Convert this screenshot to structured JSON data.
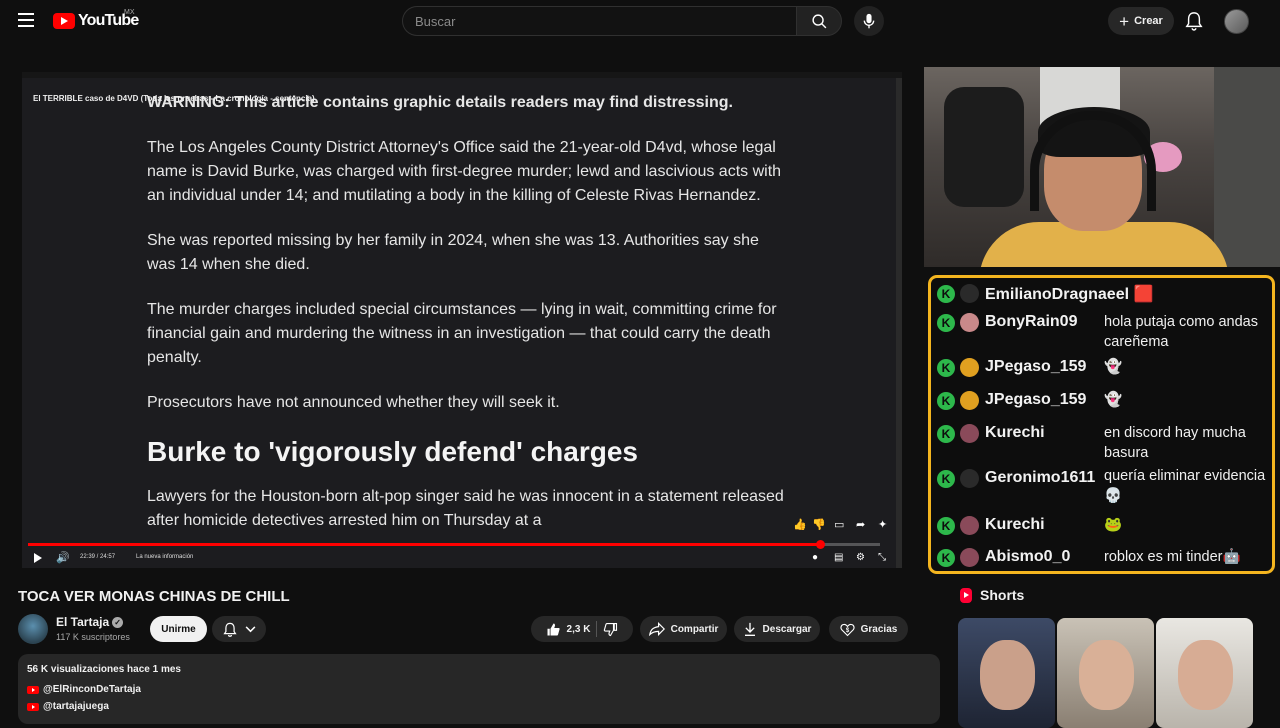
{
  "header": {
    "logo_text": "YouTube",
    "region": "MX",
    "search_placeholder": "Buscar",
    "create_label": "Crear"
  },
  "player": {
    "overlay_title": "El TERRIBLE caso de D4VD (Toda las pruebas - La cronología - sentencia)",
    "article": {
      "warning": "WARNING: This article contains graphic details readers may find distressing.",
      "paragraphs": [
        "The Los Angeles County District Attorney's Office said the 21-year-old D4vd, whose legal name is David Burke, was charged with first-degree murder; lewd and lascivious acts with an individual under 14; and mutilating a body in the killing of Celeste Rivas Hernandez.",
        "She was reported missing by her family in 2024, when she was 13. Authorities say she was 14 when she died.",
        "The murder charges included special circumstances — lying in wait, committing crime for financial gain and murdering the witness in an investigation — that could carry the death penalty.",
        "Prosecutors have not announced whether they will seek it."
      ],
      "heading": "Burke to 'vigorously defend' charges",
      "final_paragraph": "Lawyers for the Houston-born alt-pop singer said he was innocent in a statement released after homicide detectives arrested him on Thursday at a"
    },
    "time": "22:39 / 24:57",
    "chapter": "La nueva información",
    "progress_fraction": 0.93
  },
  "chat": {
    "messages": [
      {
        "name": "EmilianoDragnaeel",
        "text": "",
        "avatar_color": "#2a2a2a",
        "name_emoji": "🟥"
      },
      {
        "name": "BonyRain09",
        "text": "hola putaja como andas careñema",
        "avatar_color": "#c9898a"
      },
      {
        "name": "JPegaso_159",
        "text": "👻",
        "avatar_color": "#e0a020"
      },
      {
        "name": "JPegaso_159",
        "text": "👻",
        "avatar_color": "#e0a020"
      },
      {
        "name": "Kurechi",
        "text": "en discord hay mucha basura",
        "avatar_color": "#8a4a5a"
      },
      {
        "name": "Geronimo1611",
        "text": "quería eliminar evidencia 💀",
        "avatar_color": "#2a2a2a"
      },
      {
        "name": "Kurechi",
        "text": "🐸",
        "avatar_color": "#8a4a5a"
      },
      {
        "name": "Abismo0_0",
        "text": "roblox es mi tinder🤖",
        "avatar_color": "#8a4a5a"
      }
    ]
  },
  "video": {
    "title": "TOCA VER MONAS CHINAS DE CHILL",
    "channel": "El Tartaja",
    "subscribers": "117 K suscriptores",
    "join_label": "Unirme",
    "likes": "2,3 K",
    "share_label": "Compartir",
    "download_label": "Descargar",
    "thanks_label": "Gracias",
    "views_date": "56 K visualizaciones  hace 1 mes",
    "links": [
      "@ElRinconDeTartaja",
      "@tartajajuega"
    ]
  },
  "shorts": {
    "label": "Shorts"
  },
  "colors": {
    "brand_red": "#ff0000",
    "chat_border": "#f4b51f",
    "badge_green": "#2db84b"
  }
}
